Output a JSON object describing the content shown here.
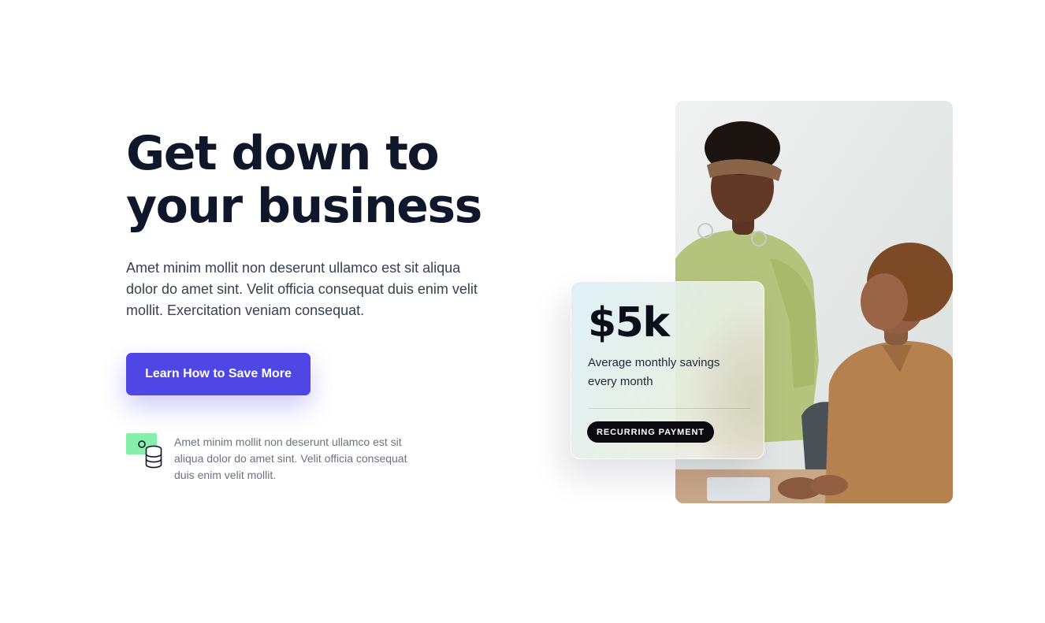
{
  "hero": {
    "title_line1": "Get down to",
    "title_line2": "your business",
    "description": "Amet minim mollit non deserunt ullamco est sit aliqua dolor do amet sint. Velit officia consequat duis enim velit mollit. Exercitation veniam consequat.",
    "cta_label": "Learn How to Save More"
  },
  "feature": {
    "icon": "money-coins-icon",
    "text": "Amet minim mollit non deserunt ullamco est sit aliqua dolor do amet sint. Velit officia consequat duis enim velit mollit."
  },
  "stat_card": {
    "value": "$5k",
    "label": "Average monthly savings every month",
    "badge": "RECURRING PAYMENT"
  },
  "colors": {
    "accent": "#4f46e5",
    "heading": "#0f172a",
    "icon_green": "#86efac"
  }
}
